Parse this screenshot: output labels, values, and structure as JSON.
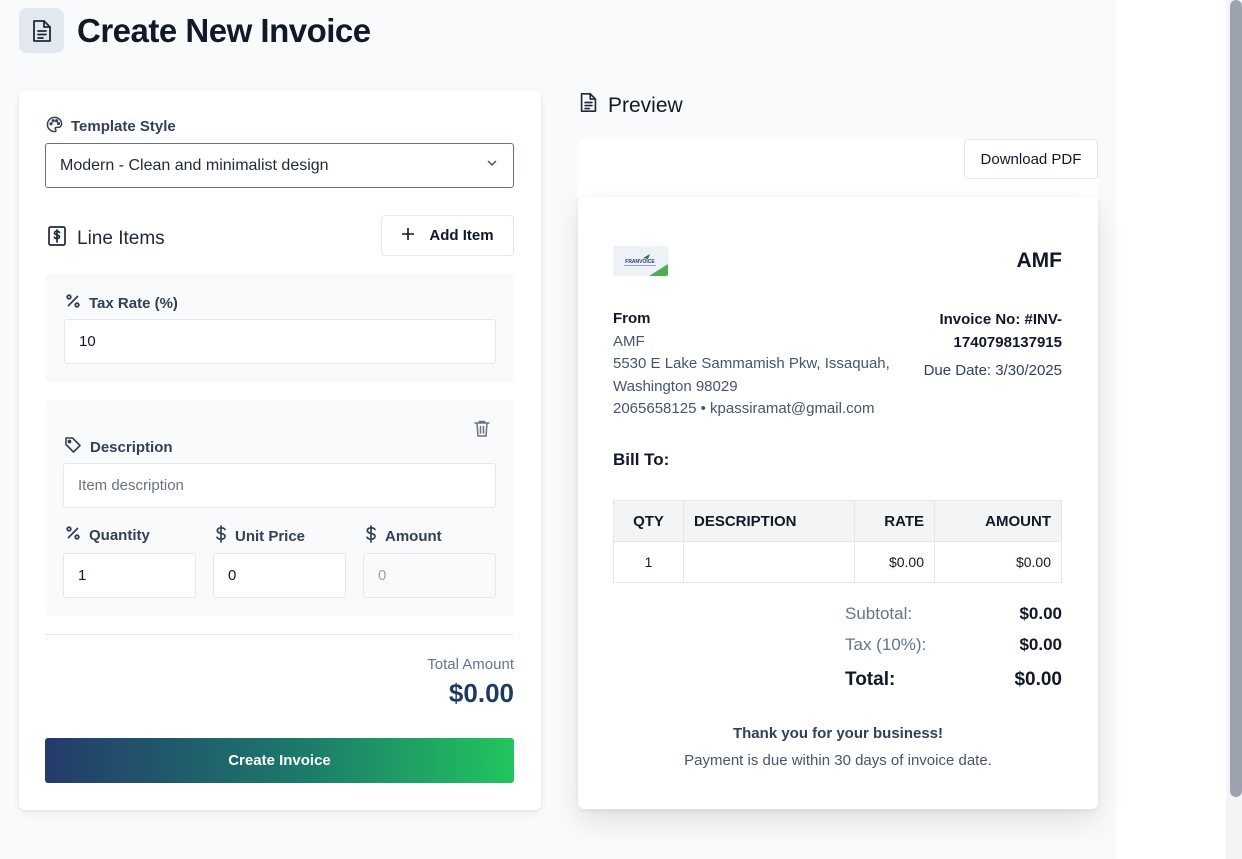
{
  "header": {
    "title": "Create New Invoice",
    "icon": "document-icon"
  },
  "form": {
    "template_label": "Template Style",
    "template_value": "Modern - Clean and minimalist design",
    "line_items_title": "Line Items",
    "add_item_label": "Add Item",
    "tax_label": "Tax Rate (%)",
    "tax_value": "10",
    "item": {
      "description_label": "Description",
      "description_placeholder": "Item description",
      "quantity_label": "Quantity",
      "quantity_value": "1",
      "unit_price_label": "Unit Price",
      "unit_price_value": "0",
      "amount_label": "Amount",
      "amount_value": "0"
    },
    "total_label": "Total Amount",
    "total_value": "$0.00",
    "create_label": "Create Invoice"
  },
  "preview": {
    "title": "Preview",
    "download_label": "Download PDF",
    "invoice": {
      "logo_text": "FRANVOICE",
      "company_short": "AMF",
      "from_label": "From",
      "from_name": "AMF",
      "address_line1": "5530 E Lake Sammamish Pkw, Issaquah,",
      "address_line2": "Washington 98029",
      "contact": "2065658125 • kpassiramat@gmail.com",
      "invoice_no": "Invoice No: #INV-1740798137915",
      "due_date": "Due Date: 3/30/2025",
      "bill_to": "Bill To:",
      "table": {
        "headers": [
          "QTY",
          "DESCRIPTION",
          "RATE",
          "AMOUNT"
        ],
        "rows": [
          {
            "qty": "1",
            "description": "",
            "rate": "$0.00",
            "amount": "$0.00"
          }
        ]
      },
      "subtotal_label": "Subtotal:",
      "subtotal_value": "$0.00",
      "tax_label": "Tax (10%):",
      "tax_value": "$0.00",
      "total_label": "Total:",
      "total_value": "$0.00",
      "thanks": "Thank you for your business!",
      "terms": "Payment is due within 30 days of invoice date."
    }
  },
  "colors": {
    "accent_navy": "#243b6b",
    "accent_green": "#22c55e",
    "total_text": "#1e3a5f"
  }
}
